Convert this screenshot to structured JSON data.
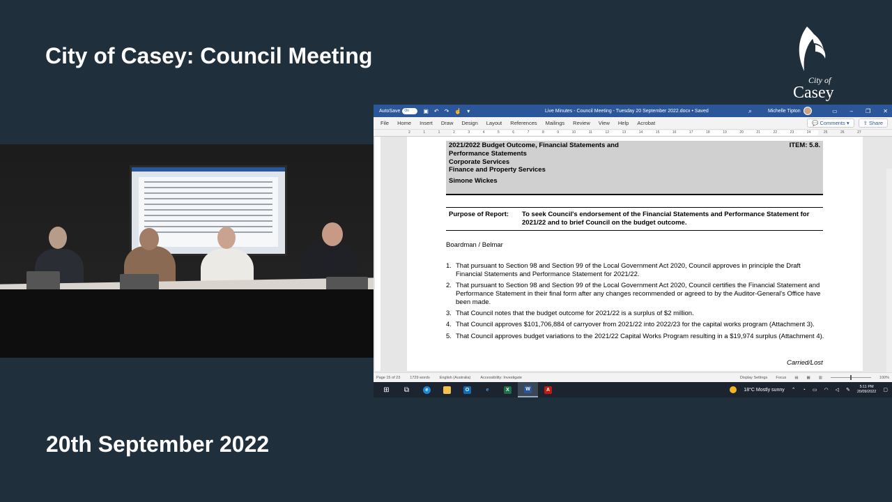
{
  "overlay": {
    "title": "City of Casey: Council Meeting",
    "date": "20th September 2022"
  },
  "logo": {
    "line1": "City of",
    "line2": "Casey"
  },
  "word": {
    "autosave_label": "AutoSave",
    "autosave_state": "On",
    "doc_title": "Live Minutes - Council Meeting - Tuesday 20 September 2022.docx",
    "saved_status": "• Saved",
    "user_name": "Michelle Tipton",
    "menu_tabs": [
      "File",
      "Home",
      "Insert",
      "Draw",
      "Design",
      "Layout",
      "References",
      "Mailings",
      "Review",
      "View",
      "Help",
      "Acrobat"
    ],
    "comments_label": "Comments",
    "share_label": "Share",
    "ruler_ticks": [
      "2",
      "1",
      "1",
      "2",
      "3",
      "4",
      "5",
      "6",
      "7",
      "8",
      "9",
      "10",
      "11",
      "12",
      "13",
      "14",
      "15",
      "16",
      "17",
      "18",
      "19",
      "20",
      "21",
      "22",
      "23",
      "24",
      "25",
      "26",
      "27"
    ]
  },
  "document": {
    "header_lines": [
      "2021/2022 Budget Outcome, Financial Statements and",
      "Performance Statements",
      "Corporate Services",
      "Finance and Property Services"
    ],
    "item": "ITEM: 5.8.",
    "author": "Simone Wickes",
    "purpose_label": "Purpose of Report:",
    "purpose_text": "To seek Council's endorsement of the Financial Statements and Performance Statement for 2021/22 and to brief Council on the budget outcome.",
    "mover": "Boardman / Belmar",
    "resolutions": [
      {
        "num": "1.",
        "text": "That pursuant to Section 98 and Section 99 of the Local Government Act 2020, Council approves in principle the Draft Financial Statements and Performance Statement for 2021/22."
      },
      {
        "num": "2.",
        "text": "That pursuant to Section 98 and Section 99 of the Local Government Act 2020, Council certifies the Financial Statement and Performance Statement in their final form after any changes recommended or agreed to by the Auditor-General's Office have been made."
      },
      {
        "num": "3.",
        "text": "That Council notes that the budget outcome for 2021/22 is a surplus of $2 million."
      },
      {
        "num": "4.",
        "text": "That Council approves $101,706,884 of carryover from 2021/22 into 2022/23 for the capital works program (Attachment 3)."
      },
      {
        "num": "5.",
        "text": "That Council approves budget variations to the 2021/22 Capital Works Program resulting in a $19,974 surplus (Attachment 4)."
      }
    ],
    "carried": "Carried/Lost"
  },
  "statusbar": {
    "page": "Page 15 of 23",
    "words": "1729 words",
    "language": "English (Australia)",
    "accessibility": "Accessibility: Investigate",
    "display": "Display Settings",
    "focus": "Focus",
    "zoom": "100%"
  },
  "taskbar": {
    "weather": "18°C  Mostly sunny",
    "time": "5:11 PM",
    "date": "20/09/2022",
    "accent": "#2b579a"
  }
}
